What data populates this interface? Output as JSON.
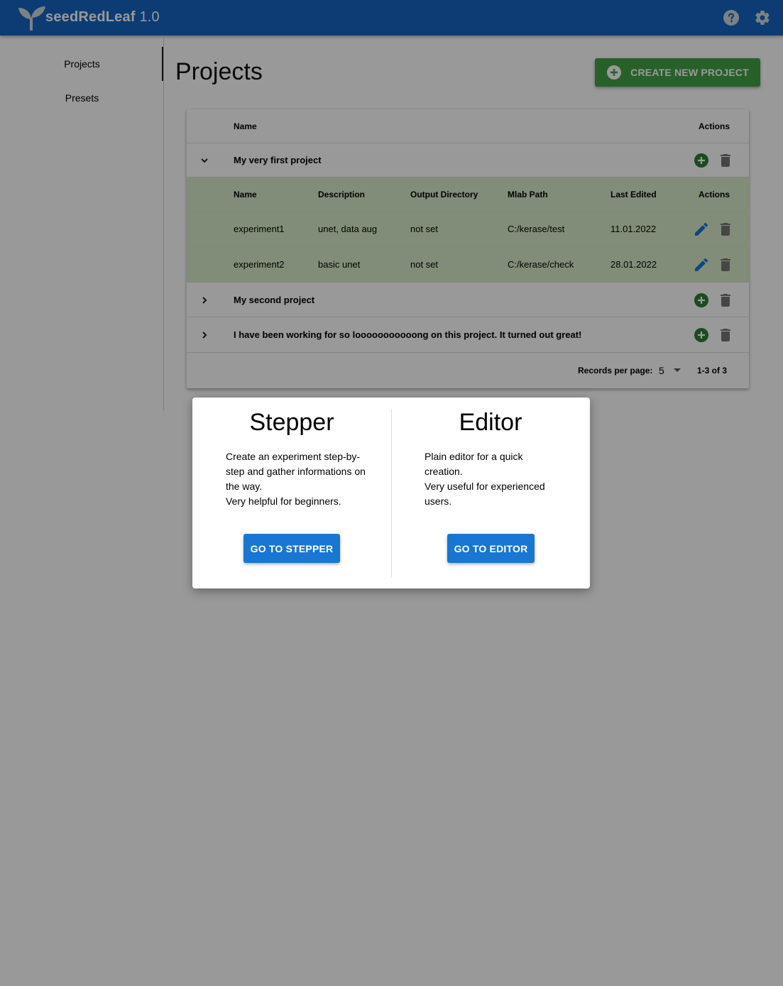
{
  "app": {
    "name": "seedRedLeaf",
    "version": "1.0"
  },
  "sidebar": {
    "items": [
      {
        "label": "Projects"
      },
      {
        "label": "Presets"
      }
    ]
  },
  "page": {
    "title": "Projects",
    "create_button": "CREATE NEW PROJECT"
  },
  "table": {
    "headers": {
      "name": "Name",
      "actions": "Actions"
    },
    "projects": [
      {
        "name": "My very first project",
        "expanded": true
      },
      {
        "name": "My second project",
        "expanded": false
      },
      {
        "name": "I have been working for so looooooooooong on this project. It turned out great!",
        "expanded": false
      }
    ],
    "experiment_headers": {
      "name": "Name",
      "description": "Description",
      "output_directory": "Output Directory",
      "mlab_path": "Mlab Path",
      "last_edited": "Last Edited",
      "actions": "Actions"
    },
    "experiments": [
      {
        "name": "experiment1",
        "description": "unet, data aug",
        "output_directory": "not set",
        "mlab_path": "C:/kerase/test",
        "last_edited": "11.01.2022"
      },
      {
        "name": "experiment2",
        "description": "basic unet",
        "output_directory": "not set",
        "mlab_path": "C:/kerase/check",
        "last_edited": "28.01.2022"
      }
    ],
    "pagination": {
      "label": "Records per page:",
      "per_page": "5",
      "range": "1-3 of 3"
    }
  },
  "dialog": {
    "stepper": {
      "title": "Stepper",
      "description": "Create an experiment step-by-step and gather informations on the way.\nVery helpful for beginners.",
      "button": "GO TO STEPPER"
    },
    "editor": {
      "title": "Editor",
      "description": "Plain editor for a quick creation.\nVery useful for experienced users.",
      "button": "GO TO EDITOR"
    }
  },
  "colors": {
    "appbar": "#1565c0",
    "create_button": "#43a047",
    "action_add": "#2e7d32",
    "subtable_bg": "#d8ecc8",
    "dialog_button": "#1976d2",
    "edit_icon": "#1976d2",
    "delete_icon": "#757575"
  }
}
